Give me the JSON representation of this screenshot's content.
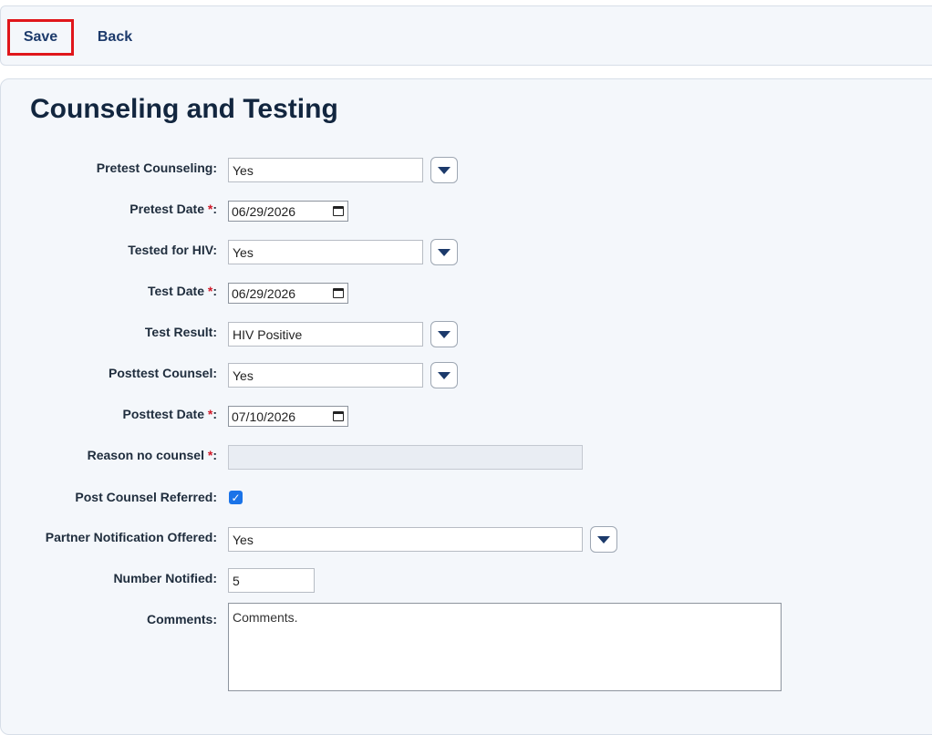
{
  "toolbar": {
    "save_label": "Save",
    "back_label": "Back"
  },
  "page": {
    "title": "Counseling and Testing"
  },
  "required_marker": "*",
  "form": {
    "pretest_counseling": {
      "label": "Pretest Counseling:",
      "value": "Yes"
    },
    "pretest_date": {
      "label": "Pretest Date ",
      "value": "06/29/2026"
    },
    "tested_for_hiv": {
      "label": "Tested for HIV:",
      "value": "Yes"
    },
    "test_date": {
      "label": "Test Date ",
      "value": "06/29/2026"
    },
    "test_result": {
      "label": "Test Result:",
      "value": "HIV Positive"
    },
    "posttest_counsel": {
      "label": "Posttest Counsel:",
      "value": "Yes"
    },
    "posttest_date": {
      "label": "Posttest Date ",
      "value": "07/10/2026"
    },
    "reason_no_counsel": {
      "label": "Reason no counsel ",
      "value": ""
    },
    "post_counsel_referred": {
      "label": "Post Counsel Referred:",
      "checked": true
    },
    "partner_notification_offered": {
      "label": "Partner Notification Offered:",
      "value": "Yes"
    },
    "number_notified": {
      "label": "Number Notified:",
      "value": "5"
    },
    "comments": {
      "label": "Comments:",
      "value": "Comments."
    }
  },
  "colors": {
    "accent": "#1c3a6b",
    "save_highlight": "#e0161b",
    "required": "#d11a2a",
    "checkbox": "#1a73e8"
  }
}
